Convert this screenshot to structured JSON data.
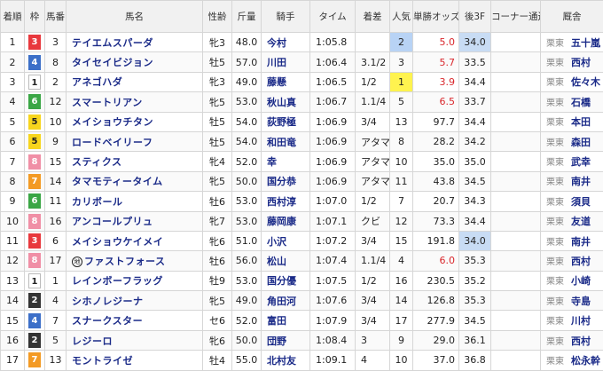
{
  "headers": {
    "rank": "着順",
    "waku": "枠",
    "umaban": "馬番",
    "horse": "馬名",
    "sexage": "性齢",
    "weight": "斤量",
    "jockey": "騎手",
    "time": "タイム",
    "margin": "着差",
    "popular": "人気",
    "odds": "単勝オッズ",
    "last3f": "後3F",
    "corner": "コーナー通過順",
    "trainer": "厩舎"
  },
  "rows": [
    {
      "rank": "1",
      "waku": "3",
      "umaban": "3",
      "horse": "テイエムスパーダ",
      "sexage": "牝3",
      "weight": "48.0",
      "jockey": "今村",
      "time": "1:05.8",
      "margin": "",
      "popular": "2",
      "odds": "5.0",
      "last3f": "34.0",
      "corner": "",
      "region": "栗東",
      "trainer": "五十嵐"
    },
    {
      "rank": "2",
      "waku": "4",
      "umaban": "8",
      "horse": "タイセイビジョン",
      "sexage": "牡5",
      "weight": "57.0",
      "jockey": "川田",
      "time": "1:06.4",
      "margin": "3.1/2",
      "popular": "3",
      "odds": "5.7",
      "last3f": "33.5",
      "corner": "",
      "region": "栗東",
      "trainer": "西村"
    },
    {
      "rank": "3",
      "waku": "1",
      "umaban": "2",
      "horse": "アネゴハダ",
      "sexage": "牝3",
      "weight": "49.0",
      "jockey": "藤懸",
      "time": "1:06.5",
      "margin": "1/2",
      "popular": "1",
      "odds": "3.9",
      "last3f": "34.4",
      "corner": "",
      "region": "栗東",
      "trainer": "佐々木"
    },
    {
      "rank": "4",
      "waku": "6",
      "umaban": "12",
      "horse": "スマートリアン",
      "sexage": "牝5",
      "weight": "53.0",
      "jockey": "秋山真",
      "time": "1:06.7",
      "margin": "1.1/4",
      "popular": "5",
      "odds": "6.5",
      "last3f": "33.7",
      "corner": "",
      "region": "栗東",
      "trainer": "石橋"
    },
    {
      "rank": "5",
      "waku": "5",
      "umaban": "10",
      "horse": "メイショウチタン",
      "sexage": "牡5",
      "weight": "54.0",
      "jockey": "荻野極",
      "time": "1:06.9",
      "margin": "3/4",
      "popular": "13",
      "odds": "97.7",
      "last3f": "34.4",
      "corner": "",
      "region": "栗東",
      "trainer": "本田"
    },
    {
      "rank": "6",
      "waku": "5",
      "umaban": "9",
      "horse": "ロードベイリーフ",
      "sexage": "牡5",
      "weight": "54.0",
      "jockey": "和田竜",
      "time": "1:06.9",
      "margin": "アタマ",
      "popular": "8",
      "odds": "28.2",
      "last3f": "34.2",
      "corner": "",
      "region": "栗東",
      "trainer": "森田"
    },
    {
      "rank": "7",
      "waku": "8",
      "umaban": "15",
      "horse": "スティクス",
      "sexage": "牝4",
      "weight": "52.0",
      "jockey": "幸",
      "time": "1:06.9",
      "margin": "アタマ",
      "popular": "10",
      "odds": "35.0",
      "last3f": "35.0",
      "corner": "",
      "region": "栗東",
      "trainer": "武幸"
    },
    {
      "rank": "8",
      "waku": "7",
      "umaban": "14",
      "horse": "タマモティータイム",
      "sexage": "牝5",
      "weight": "50.0",
      "jockey": "国分恭",
      "time": "1:06.9",
      "margin": "アタマ",
      "popular": "11",
      "odds": "43.8",
      "last3f": "34.5",
      "corner": "",
      "region": "栗東",
      "trainer": "南井"
    },
    {
      "rank": "9",
      "waku": "6",
      "umaban": "11",
      "horse": "カリボール",
      "sexage": "牡6",
      "weight": "53.0",
      "jockey": "西村淳",
      "time": "1:07.0",
      "margin": "1/2",
      "popular": "7",
      "odds": "20.7",
      "last3f": "34.3",
      "corner": "",
      "region": "栗東",
      "trainer": "須貝"
    },
    {
      "rank": "10",
      "waku": "8",
      "umaban": "16",
      "horse": "アンコールプリュ",
      "sexage": "牝7",
      "weight": "53.0",
      "jockey": "藤岡康",
      "time": "1:07.1",
      "margin": "クビ",
      "popular": "12",
      "odds": "73.3",
      "last3f": "34.4",
      "corner": "",
      "region": "栗東",
      "trainer": "友道"
    },
    {
      "rank": "11",
      "waku": "3",
      "umaban": "6",
      "horse": "メイショウケイメイ",
      "sexage": "牝6",
      "weight": "51.0",
      "jockey": "小沢",
      "time": "1:07.2",
      "margin": "3/4",
      "popular": "15",
      "odds": "191.8",
      "last3f": "34.0",
      "corner": "",
      "region": "栗東",
      "trainer": "南井"
    },
    {
      "rank": "12",
      "waku": "8",
      "umaban": "17",
      "horse": "ファストフォース",
      "maru": "地",
      "sexage": "牡6",
      "weight": "56.0",
      "jockey": "松山",
      "time": "1:07.4",
      "margin": "1.1/4",
      "popular": "4",
      "odds": "6.0",
      "last3f": "35.3",
      "corner": "",
      "region": "栗東",
      "trainer": "西村"
    },
    {
      "rank": "13",
      "waku": "1",
      "umaban": "1",
      "horse": "レインボーフラッグ",
      "sexage": "牡9",
      "weight": "53.0",
      "jockey": "国分優",
      "time": "1:07.5",
      "margin": "1/2",
      "popular": "16",
      "odds": "230.5",
      "last3f": "35.2",
      "corner": "",
      "region": "栗東",
      "trainer": "小崎"
    },
    {
      "rank": "14",
      "waku": "2",
      "umaban": "4",
      "horse": "シホノレジーナ",
      "sexage": "牝5",
      "weight": "49.0",
      "jockey": "角田河",
      "time": "1:07.6",
      "margin": "3/4",
      "popular": "14",
      "odds": "126.8",
      "last3f": "35.3",
      "corner": "",
      "region": "栗東",
      "trainer": "寺島"
    },
    {
      "rank": "15",
      "waku": "4",
      "umaban": "7",
      "horse": "スナークスター",
      "sexage": "セ6",
      "weight": "52.0",
      "jockey": "富田",
      "time": "1:07.9",
      "margin": "3/4",
      "popular": "17",
      "odds": "277.9",
      "last3f": "34.5",
      "corner": "",
      "region": "栗東",
      "trainer": "川村"
    },
    {
      "rank": "16",
      "waku": "2",
      "umaban": "5",
      "horse": "レジーロ",
      "sexage": "牝6",
      "weight": "50.0",
      "jockey": "団野",
      "time": "1:08.4",
      "margin": "3",
      "popular": "9",
      "odds": "29.0",
      "last3f": "36.1",
      "corner": "",
      "region": "栗東",
      "trainer": "西村"
    },
    {
      "rank": "17",
      "waku": "7",
      "umaban": "13",
      "horse": "モントライゼ",
      "sexage": "牡4",
      "weight": "55.0",
      "jockey": "北村友",
      "time": "1:09.1",
      "margin": "4",
      "popular": "10",
      "odds": "37.0",
      "last3f": "36.8",
      "corner": "",
      "region": "栗東",
      "trainer": "松永幹"
    }
  ]
}
